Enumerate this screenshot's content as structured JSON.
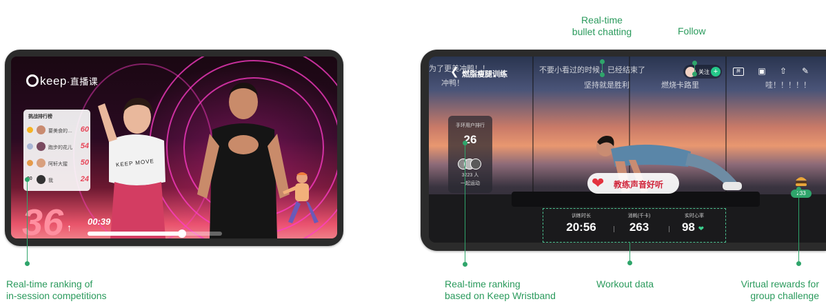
{
  "left_screen": {
    "logo": "keep",
    "logo_suffix": "·直播课",
    "ranking_title": "挑战排行榜",
    "ranking": [
      {
        "name": "要美食的…",
        "score": "60",
        "medal": "#f5b324"
      },
      {
        "name": "跑步的花儿",
        "score": "54",
        "medal": "#a9b6d6"
      },
      {
        "name": "阿轩大猩",
        "score": "50",
        "medal": "#e59a4a"
      },
      {
        "rank": "20",
        "name": "我",
        "score": "24"
      }
    ],
    "shirt_text": "KEEP MOVE",
    "count": "36",
    "count_arrow": "↑",
    "timer": "00:39",
    "progress": 0.7
  },
  "right_screen": {
    "title": "燃脂瘦腿训练",
    "bullets": [
      "为了更美冲鸭！！",
      "冲鸭！",
      "不要小看过的时候，已经结束了",
      "坚持就是胜利",
      "燃烧卡路里",
      "哇！！！！！"
    ],
    "follow_label": "关注",
    "wristband": {
      "title": "手环用户排行",
      "rank": "26",
      "count": "3223 人",
      "sub": "一起运动"
    },
    "praise": "教练声音好听",
    "reward_count": "233",
    "workout": [
      {
        "label": "训练时长",
        "value": "20:56"
      },
      {
        "label": "消耗(千卡)",
        "value": "263"
      },
      {
        "label": "实时心率",
        "value": "98"
      }
    ]
  },
  "annotations": {
    "bullet_chatting": [
      "Real-time",
      "bullet chatting"
    ],
    "follow": "Follow",
    "left_ranking": [
      "Real-time ranking of",
      "in-session competitions"
    ],
    "wristband_ranking": [
      "Real-time ranking",
      "based on Keep Wristband"
    ],
    "workout_data": "Workout data",
    "virtual_rewards": [
      "Virtual rewards for",
      "group challenge"
    ]
  },
  "colors": {
    "annotation": "#2fa56b",
    "accent_pink": "#e8475a"
  }
}
